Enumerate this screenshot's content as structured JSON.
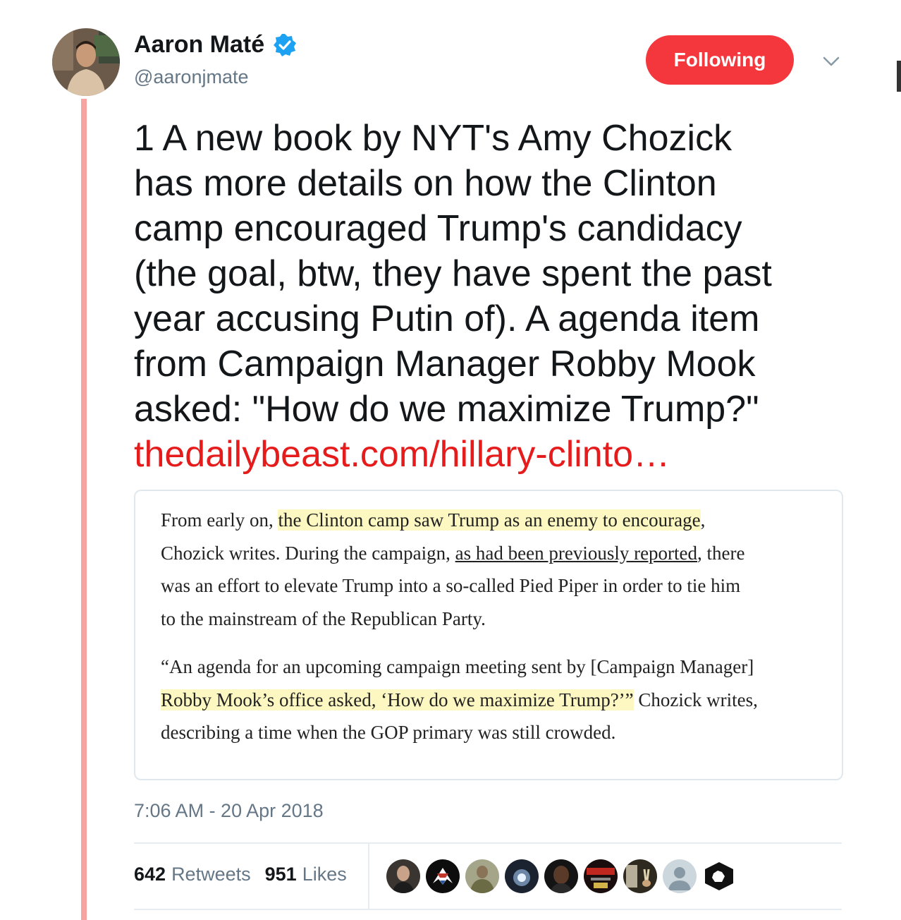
{
  "author": {
    "name": "Aaron Maté",
    "handle": "@aaronjmate",
    "verified": true
  },
  "follow_button": {
    "label": "Following"
  },
  "menu": {
    "icon": "chevron-down-icon"
  },
  "tweet": {
    "lines": [
      "1 A new book by NYT's Amy Chozick",
      "has more details on how the Clinton",
      "camp encouraged Trump's candidacy",
      "(the goal, btw, they have spent the past",
      "year accusing Putin of). A agenda item",
      "from Campaign Manager Robby Mook",
      "asked: \"How do we maximize Trump?\""
    ],
    "link": "thedailybeast.com/hillary-clinto…"
  },
  "card": {
    "p1": {
      "l1_a": "From early on, ",
      "l1_hl": "the Clinton camp saw Trump as an enemy to encourage",
      "l1_b": ",",
      "l2_a": "Chozick writes. During the campaign, ",
      "l2_link": "as had been previously reported",
      "l2_b": ", there",
      "l3": "was an effort to elevate Trump into a so-called Pied Piper in order to tie him",
      "l4": "to the mainstream of the Republican Party."
    },
    "p2": {
      "l1": "“An agenda for an upcoming campaign meeting sent by [Campaign Manager]",
      "l2_hl": "Robby Mook’s office asked, ‘How do we maximize Trump?’”",
      "l2_b": " Chozick writes,",
      "l3": "describing a time when the GOP primary was still crowded."
    }
  },
  "timestamp": "7:06 AM - 20 Apr 2018",
  "stats": {
    "retweets_count": "642",
    "retweets_label": "Retweets",
    "likes_count": "951",
    "likes_label": "Likes"
  },
  "colors": {
    "follow_bg": "#f4373c",
    "link": "#e61b1b",
    "thread_line": "#f7a3a0",
    "verified": "#1da1f2",
    "highlight": "#fdf8c2"
  },
  "likers": [
    "avatar-man-suit",
    "avatar-eagle-logo",
    "avatar-soldier",
    "avatar-dark-glow",
    "avatar-man-dark",
    "avatar-betrayed-dnc",
    "avatar-war-peace",
    "avatar-default",
    "avatar-fist-logo"
  ]
}
